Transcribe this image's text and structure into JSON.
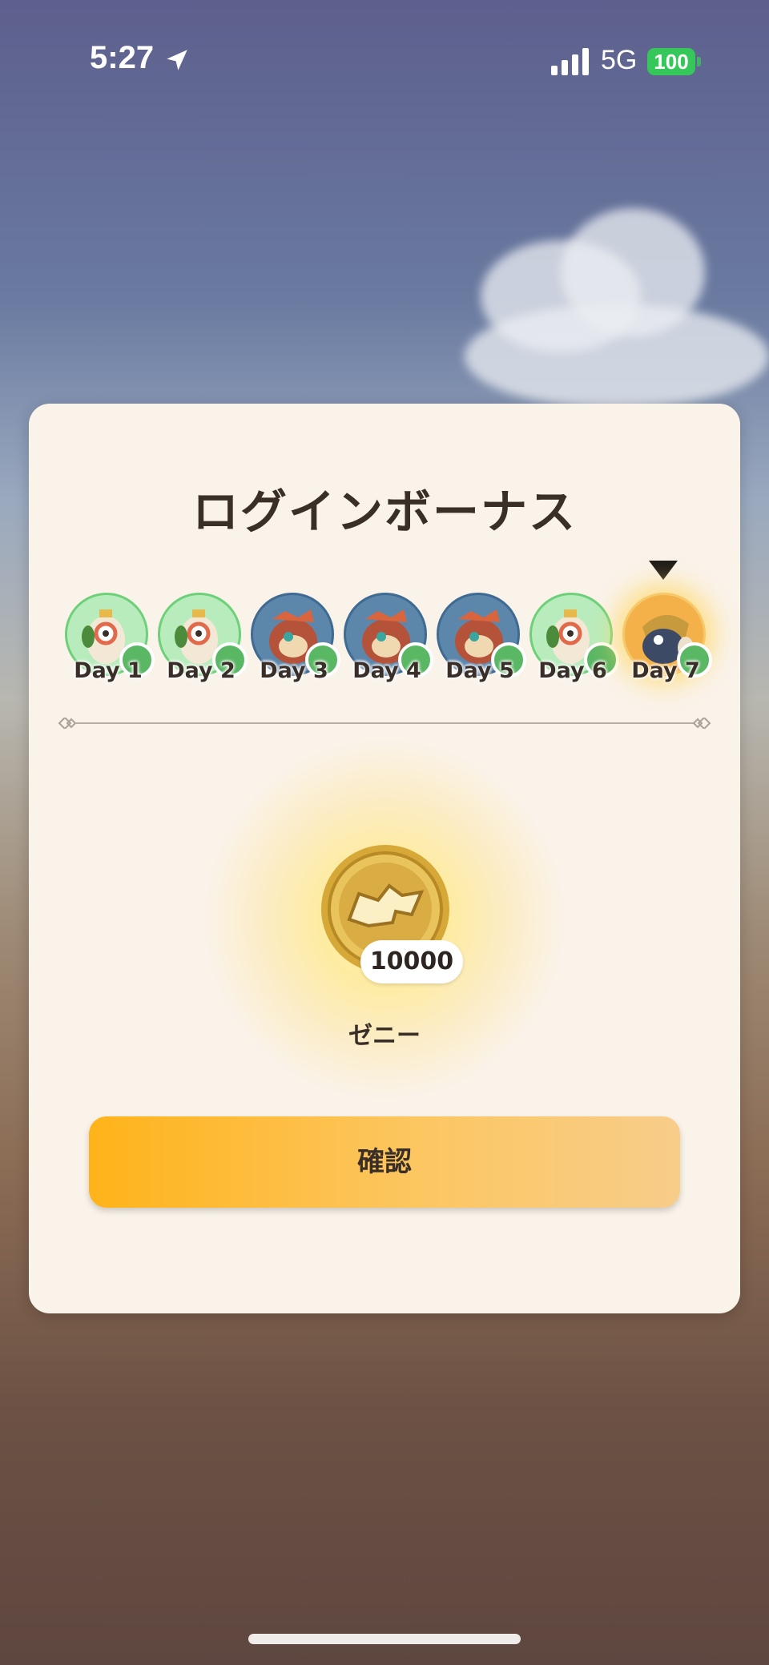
{
  "status_bar": {
    "time": "5:27",
    "network": "5G",
    "battery": "100"
  },
  "dialog": {
    "title": "ログインボーナス",
    "days": [
      {
        "label": "Day 1",
        "icon": "bird-mascot-icon",
        "style": "green"
      },
      {
        "label": "Day 2",
        "icon": "bird-mascot-icon",
        "style": "green"
      },
      {
        "label": "Day 3",
        "icon": "monster-mascot-icon",
        "style": "blue"
      },
      {
        "label": "Day 4",
        "icon": "monster-mascot-icon",
        "style": "blue"
      },
      {
        "label": "Day 5",
        "icon": "monster-mascot-icon",
        "style": "blue"
      },
      {
        "label": "Day 6",
        "icon": "bird-mascot-icon",
        "style": "green"
      },
      {
        "label": "Day 7",
        "icon": "armored-mascot-icon",
        "style": "gold"
      }
    ],
    "current_day": "Day 7",
    "reward": {
      "icon": "zenny-coin-icon",
      "amount": "10000",
      "name": "ゼニー"
    },
    "confirm_label": "確認"
  },
  "colors": {
    "card_bg": "#faf3ea",
    "button_start": "#ffb31a",
    "button_end": "#f7cd8a",
    "text": "#3a2f28",
    "battery": "#35c759"
  }
}
